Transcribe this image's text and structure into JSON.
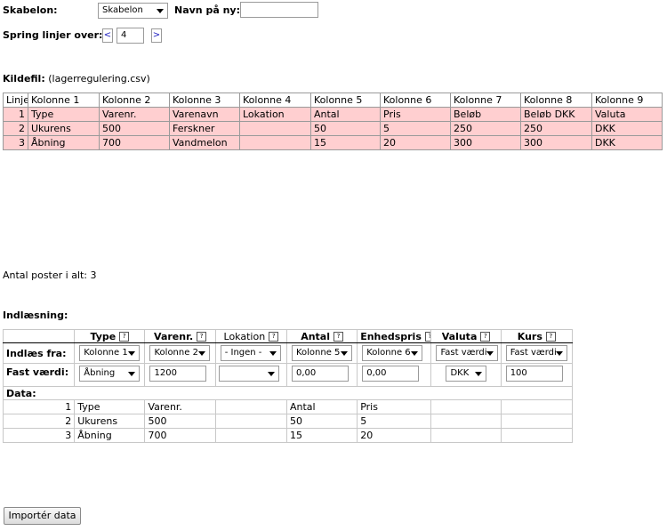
{
  "template": {
    "label": "Skabelon:",
    "selected": "Skabelon"
  },
  "new_name": {
    "label": "Navn på ny:",
    "value": ""
  },
  "skip": {
    "label": "Spring linjer over:",
    "prev": "<",
    "value": "4",
    "next": ">"
  },
  "source": {
    "label": "Kildefil:",
    "filename": "(lagerregulering.csv)"
  },
  "source_table": {
    "headers": [
      "Linje",
      "Kolonne 1",
      "Kolonne 2",
      "Kolonne 3",
      "Kolonne 4",
      "Kolonne 5",
      "Kolonne 6",
      "Kolonne 7",
      "Kolonne 8",
      "Kolonne 9"
    ],
    "rows": [
      [
        "1",
        "Type",
        "Varenr.",
        "Varenavn",
        "Lokation",
        "Antal",
        "Pris",
        "Beløb",
        "Beløb DKK",
        "Valuta"
      ],
      [
        "2",
        "Ukurens",
        "500",
        "Ferskner",
        "",
        "50",
        "5",
        "250",
        "250",
        "DKK"
      ],
      [
        "3",
        "Åbning",
        "700",
        "Vandmelon",
        "",
        "15",
        "20",
        "300",
        "300",
        "DKK"
      ]
    ]
  },
  "total": "Antal poster i alt: 3",
  "import": {
    "label": "Indlæsning:",
    "help_glyph": "?",
    "headers": [
      "Type",
      "Varenr.",
      "Lokation",
      "Antal",
      "Enhedspris",
      "Valuta",
      "Kurs"
    ],
    "read_from": {
      "label": "Indlæs fra:",
      "values": [
        "Kolonne 1",
        "Kolonne 2",
        "- Ingen -",
        "Kolonne 5",
        "Kolonne 6",
        "Fast værdi",
        "Fast værdi"
      ]
    },
    "fixed": {
      "label": "Fast værdi:",
      "type": "Åbning",
      "varenr": "1200",
      "lokation": "",
      "antal": "0,00",
      "enhedspris": "0,00",
      "valuta": "DKK",
      "kurs": "100"
    },
    "data_label": "Data:",
    "data_rows": [
      [
        "1",
        "Type",
        "Varenr.",
        "",
        "Antal",
        "Pris",
        "",
        ""
      ],
      [
        "2",
        "Ukurens",
        "500",
        "",
        "50",
        "5",
        "",
        ""
      ],
      [
        "3",
        "Åbning",
        "700",
        "",
        "15",
        "20",
        "",
        ""
      ]
    ]
  },
  "import_button": "Importér data"
}
